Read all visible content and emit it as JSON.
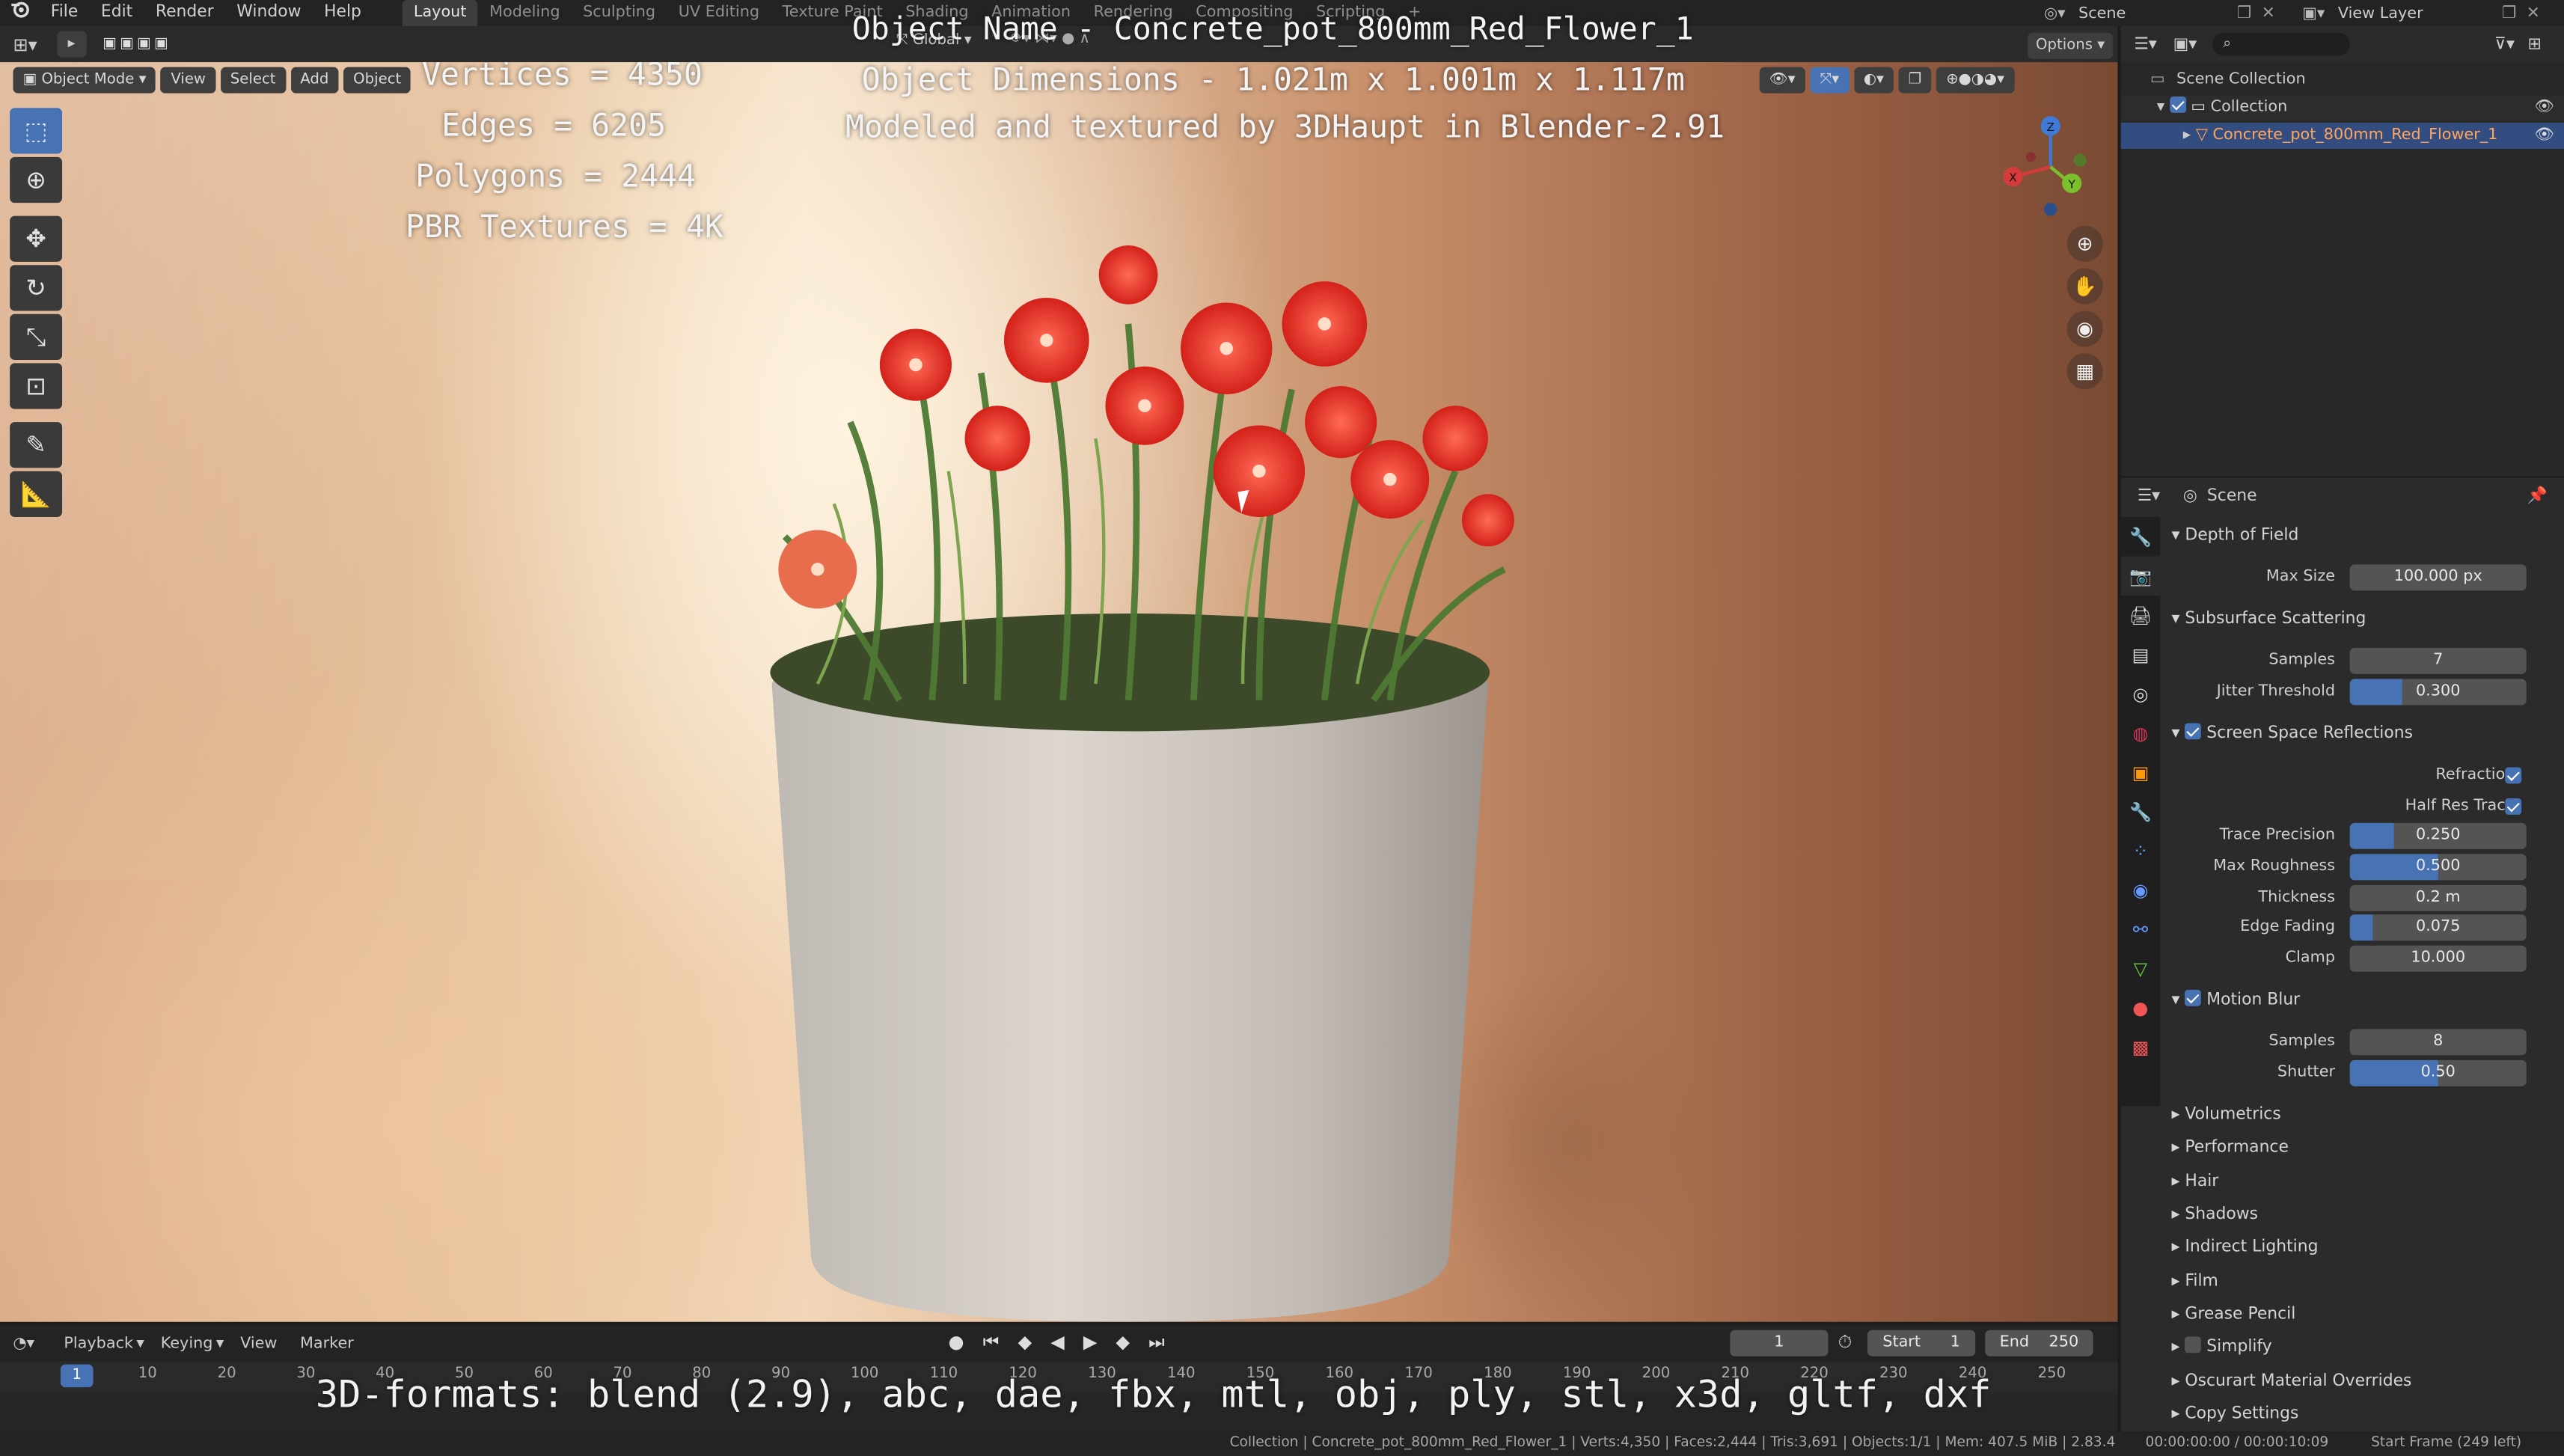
{
  "topbar": {
    "menus": [
      "File",
      "Edit",
      "Render",
      "Window",
      "Help"
    ],
    "workspaces": [
      "Layout",
      "Modeling",
      "Sculpting",
      "UV Editing",
      "Texture Paint",
      "Shading",
      "Animation",
      "Rendering",
      "Compositing",
      "Scripting"
    ],
    "active_workspace": "Layout",
    "scene_label": "Scene",
    "view_layer_label": "View Layer",
    "add_tab": "+"
  },
  "viewport_header": {
    "mode": "Object Mode",
    "view": "View",
    "select": "Select",
    "add": "Add",
    "object": "Object",
    "orientation": "Global",
    "options": "Options"
  },
  "overlay": {
    "stats": [
      "Vertices = 4350",
      "Edges = 6205",
      "Polygons = 2444",
      "PBR Textures = 4K"
    ],
    "object_name": "Object Name - Concrete_pot_800mm_Red_Flower_1",
    "object_dims": "Object Dimensions -  1.021m x 1.001m x 1.117m",
    "credit": "Modeled and textured by 3DHaupt in Blender-2.91",
    "formats": "3D-formats: blend (2.9), abc, dae, fbx, mtl, obj, ply, stl, x3d, gltf, dxf"
  },
  "gizmo": {
    "x": "X",
    "y": "Y",
    "z": "Z"
  },
  "outliner": {
    "scene_collection": "Scene Collection",
    "collection": "Collection",
    "object": "Concrete_pot_800mm_Red_Flower_1"
  },
  "properties": {
    "context": "Scene",
    "dof": {
      "title": "Depth of Field",
      "max_size_label": "Max Size",
      "max_size": "100.000 px"
    },
    "sss": {
      "title": "Subsurface Scattering",
      "samples_label": "Samples",
      "samples": "7",
      "jitter_label": "Jitter Threshold",
      "jitter": "0.300",
      "jitter_fraction": 0.3
    },
    "ssr": {
      "title": "Screen Space Reflections",
      "enabled": true,
      "refraction_label": "Refraction",
      "half_res_label": "Half Res Trace",
      "trace_precision_label": "Trace Precision",
      "trace_precision": "0.250",
      "trace_precision_fraction": 0.25,
      "max_roughness_label": "Max Roughness",
      "max_roughness": "0.500",
      "max_roughness_fraction": 0.5,
      "thickness_label": "Thickness",
      "thickness": "0.2 m",
      "edge_fading_label": "Edge Fading",
      "edge_fading": "0.075",
      "edge_fading_fraction": 0.13,
      "clamp_label": "Clamp",
      "clamp": "10.000"
    },
    "motion_blur": {
      "title": "Motion Blur",
      "enabled": true,
      "samples_label": "Samples",
      "samples": "8",
      "shutter_label": "Shutter",
      "shutter": "0.50",
      "shutter_fraction": 0.5
    },
    "collapsed": [
      "Volumetrics",
      "Performance",
      "Hair",
      "Shadows",
      "Indirect Lighting",
      "Film",
      "Grease Pencil",
      "Simplify",
      "Oscurart Material Overrides",
      "Copy Settings"
    ]
  },
  "timeline": {
    "playback": "Playback",
    "keying": "Keying",
    "view": "View",
    "marker": "Marker",
    "current_frame": "1",
    "start_label": "Start",
    "start": "1",
    "end_label": "End",
    "end": "250",
    "ticks": [
      "1",
      "10",
      "20",
      "30",
      "40",
      "50",
      "60",
      "70",
      "80",
      "90",
      "100",
      "110",
      "120",
      "130",
      "140",
      "150",
      "160",
      "170",
      "180",
      "190",
      "200",
      "210",
      "220",
      "230",
      "240",
      "250"
    ]
  },
  "statusbar": {
    "info": "Collection | Concrete_pot_800mm_Red_Flower_1 | Verts:4,350 | Faces:2,444 | Tris:3,691 | Objects:1/1 | Mem: 407.5 MiB | 2.83.4",
    "time": "00:00:00:00 / 00:00:10:09",
    "start_frame": "Start Frame (249 left)"
  }
}
